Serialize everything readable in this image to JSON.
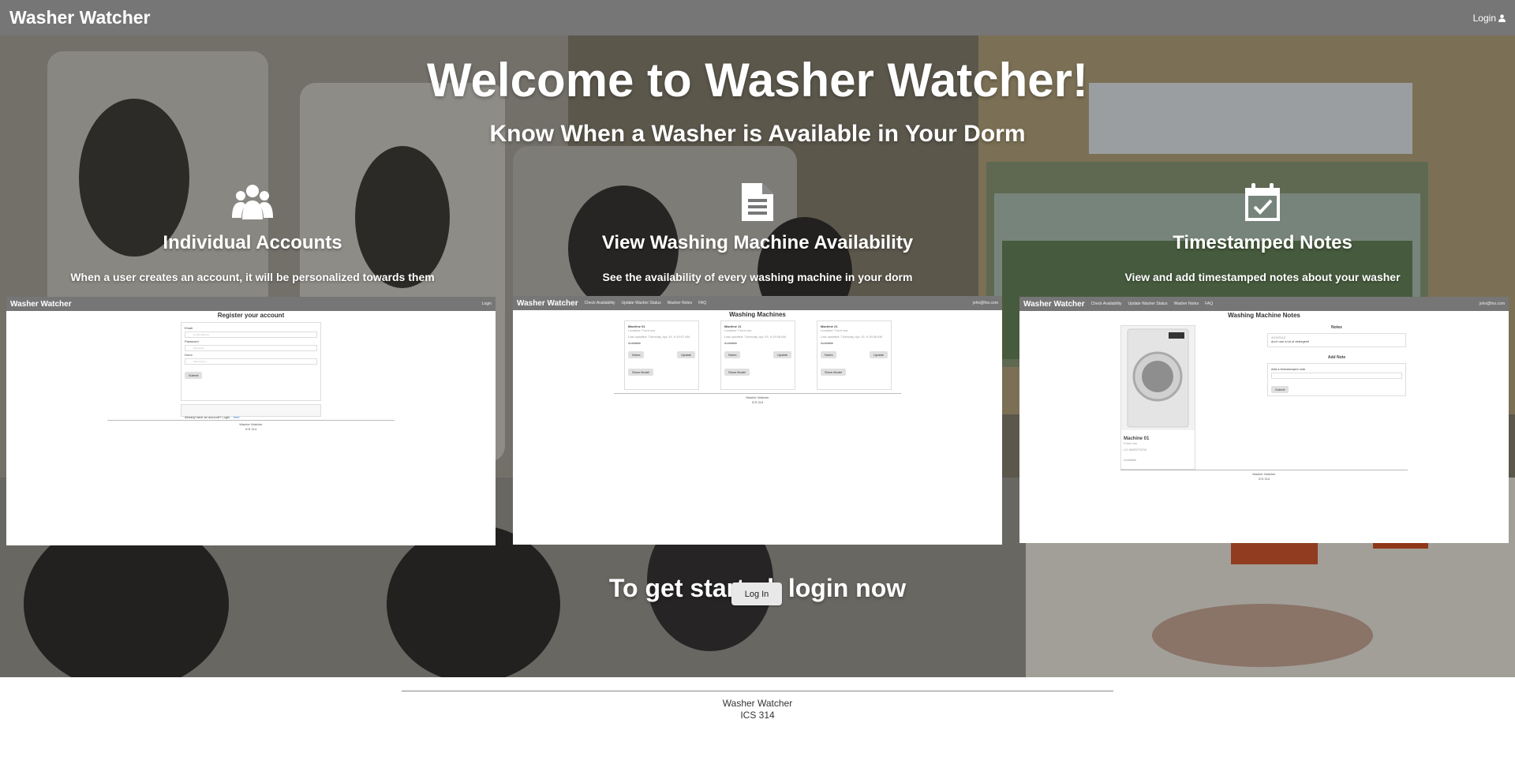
{
  "navbar": {
    "brand": "Washer Watcher",
    "login_label": "Login"
  },
  "hero": {
    "title": "Welcome to Washer Watcher!",
    "subtitle": "Know When a Washer is Available in Your Dorm",
    "features": [
      {
        "icon": "users-icon",
        "title": "Individual Accounts",
        "description": "When a user creates an account, it will be personalized towards them"
      },
      {
        "icon": "document-icon",
        "title": "View Washing Machine Availability",
        "description": "See the availability of every washing machine in your dorm"
      },
      {
        "icon": "calendar-check-icon",
        "title": "Timestamped Notes",
        "description": "View and add timestamped notes about your washer"
      }
    ],
    "cta_text": "To get started, login now",
    "cta_button": "Log In"
  },
  "screenshots": {
    "register": {
      "brand": "Washer Watcher",
      "login": "Login",
      "title": "Register your account",
      "email_label": "Email",
      "email_placeholder": "E-mail address",
      "password_label": "Password",
      "password_placeholder": "Password",
      "dorm_label": "Dorm",
      "dorm_placeholder": "Select Dorm",
      "submit": "Submit",
      "have_account": "Already have an account? Login",
      "here": "here",
      "footer1": "Washer Watcher",
      "footer2": "ICS 314"
    },
    "machines": {
      "brand": "Washer Watcher",
      "nav": [
        "Check Availability",
        "Update Washer Status",
        "Washer Notes",
        "FAQ"
      ],
      "user": "john@foo.com",
      "title": "Washing Machines",
      "cards": [
        {
          "name": "Machine 01",
          "loc": "Location: Front row",
          "updated": "Last updated: Thursday, Apr 19, 9:19:07 AM",
          "status": "Available"
        },
        {
          "name": "Machine 11",
          "loc": "Location: Front row",
          "updated": "Last updated: Thursday, Apr 19, 9:19:08 AM",
          "status": "Available"
        },
        {
          "name": "Machine 21",
          "loc": "Location: Front row",
          "updated": "Last updated: Thursday, Apr 19, 9:19:08 AM",
          "status": "Available"
        }
      ],
      "notes_btn": "Notes",
      "update_btn": "Update",
      "show_btn": "Show Model",
      "footer1": "Washer Watcher",
      "footer2": "ICS 314"
    },
    "notes": {
      "brand": "Washer Watcher",
      "nav": [
        "Check Availability",
        "Update Washer Status",
        "Washer Notes",
        "FAQ"
      ],
      "user": "john@foo.com",
      "title": "Washing Machine Notes",
      "machine_name": "Machine 01",
      "machine_loc": "Front row",
      "machine_model": "LG WM3270CW",
      "machine_status": "Available",
      "notes_header": "Notes",
      "note_time": "4/19/2018",
      "note_text": "don't use a lot of detergent!",
      "add_header": "Add Note",
      "add_label": "Add a timestamped note",
      "submit": "Submit",
      "footer1": "Washer Watcher",
      "footer2": "ICS 314"
    }
  },
  "footer": {
    "line1": "Washer Watcher",
    "line2": "ICS 314"
  }
}
